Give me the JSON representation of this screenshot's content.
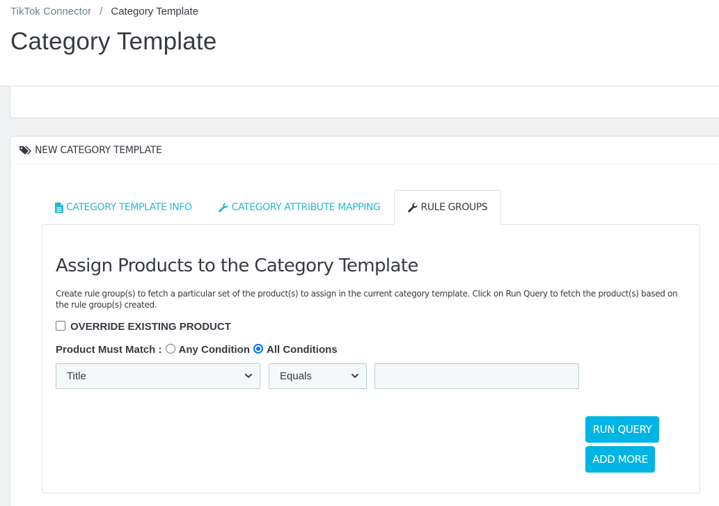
{
  "breadcrumb": {
    "parent": "TikTok Connector",
    "separator": "/",
    "current": "Category Template"
  },
  "page": {
    "title": "Category Template"
  },
  "panel": {
    "heading": "NEW CATEGORY TEMPLATE",
    "heading_icon": "tags-icon"
  },
  "tabs": [
    {
      "label": "CATEGORY TEMPLATE INFO",
      "icon": "file-icon",
      "active": false
    },
    {
      "label": "CATEGORY ATTRIBUTE MAPPING",
      "icon": "wrench-icon",
      "active": false
    },
    {
      "label": "RULE GROUPS",
      "icon": "wrench-icon",
      "active": true
    }
  ],
  "rule_groups": {
    "title": "Assign Products to the Category Template",
    "description": "Create rule group(s) to fetch a particular set of the product(s) to assign in the current category template. Click on Run Query to fetch the product(s) based on the rule group(s) created.",
    "override_label": "OVERRIDE EXISTING PRODUCT",
    "override_checked": false,
    "match_label": "Product Must Match :",
    "any_condition_label": "Any Condition",
    "all_conditions_label": "All Conditions",
    "selected_match": "All Conditions",
    "attribute_select": "Title",
    "operator_select": "Equals",
    "value_input": "",
    "run_query_label": "RUN QUERY",
    "add_more_label": "ADD MORE"
  },
  "colors": {
    "accent": "#25b9d7",
    "button": "#00b4e5",
    "radio_checked": "#0075ff"
  }
}
